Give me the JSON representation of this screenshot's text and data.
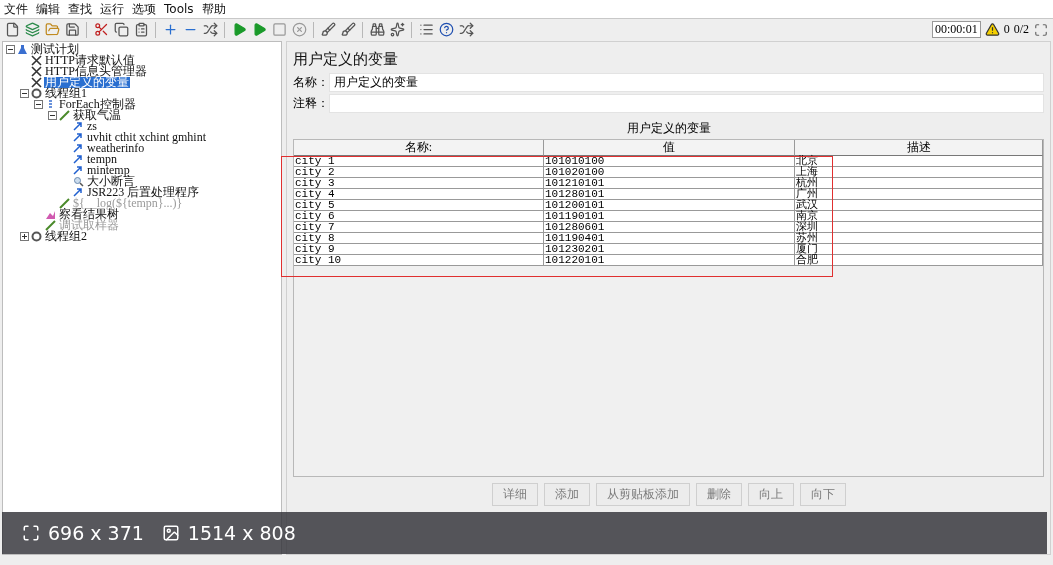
{
  "menu": [
    "文件",
    "编辑",
    "查找",
    "运行",
    "选项",
    "Tools",
    "帮助"
  ],
  "status": {
    "timer": "00:00:01",
    "warnings": "0",
    "threads": "0/2"
  },
  "tree": [
    {
      "label": "测试计划",
      "kind": "plan",
      "expanded": true,
      "selected": false,
      "disabled": false,
      "children": [
        {
          "label": "HTTP请求默认值",
          "kind": "config",
          "selected": false,
          "disabled": false
        },
        {
          "label": "HTTP信息头管理器",
          "kind": "config",
          "selected": false,
          "disabled": false
        },
        {
          "label": "用户定义的变量",
          "kind": "config",
          "selected": true,
          "disabled": false
        },
        {
          "label": "线程组1",
          "kind": "thread",
          "expanded": true,
          "selected": false,
          "disabled": false,
          "children": [
            {
              "label": "ForEach控制器",
              "kind": "controller",
              "expanded": true,
              "selected": false,
              "disabled": false,
              "children": [
                {
                  "label": "获取气温",
                  "kind": "sampler",
                  "expanded": true,
                  "selected": false,
                  "disabled": false,
                  "children": [
                    {
                      "label": "zs",
                      "kind": "extractor",
                      "selected": false,
                      "disabled": false
                    },
                    {
                      "label": "uvhit cthit xchint gmhint",
                      "kind": "extractor",
                      "selected": false,
                      "disabled": false
                    },
                    {
                      "label": "weatherinfo",
                      "kind": "extractor",
                      "selected": false,
                      "disabled": false
                    },
                    {
                      "label": "tempn",
                      "kind": "extractor",
                      "selected": false,
                      "disabled": false
                    },
                    {
                      "label": "mintemp",
                      "kind": "extractor",
                      "selected": false,
                      "disabled": false
                    },
                    {
                      "label": "大小断言",
                      "kind": "assertion",
                      "selected": false,
                      "disabled": false
                    },
                    {
                      "label": "JSR223 后置处理程序",
                      "kind": "extractor",
                      "selected": false,
                      "disabled": false
                    }
                  ]
                },
                {
                  "label": "${__log(${tempn}...)}",
                  "kind": "sampler",
                  "selected": false,
                  "disabled": true
                }
              ]
            },
            {
              "label": "察看结果树",
              "kind": "listener",
              "selected": false,
              "disabled": false
            },
            {
              "label": "调试取样器",
              "kind": "sampler",
              "selected": false,
              "disabled": true
            }
          ]
        },
        {
          "label": "线程组2",
          "kind": "thread",
          "expanded": false,
          "selected": false,
          "disabled": false
        }
      ]
    }
  ],
  "panel": {
    "title": "用户定义的变量",
    "name_label": "名称：",
    "name_value": "用户定义的变量",
    "comment_label": "注释：",
    "table_title": "用户定义的变量",
    "columns": [
      "名称:",
      "值",
      "描述"
    ],
    "rows": [
      [
        "city 1",
        "101010100",
        "北京"
      ],
      [
        "city 2",
        "101020100",
        "上海"
      ],
      [
        "city 3",
        "101210101",
        "杭州"
      ],
      [
        "city 4",
        "101280101",
        "广州"
      ],
      [
        "city 5",
        "101200101",
        "武汉"
      ],
      [
        "city 6",
        "101190101",
        "南京"
      ],
      [
        "city 7",
        "101280601",
        "深圳"
      ],
      [
        "city 8",
        "101190401",
        "苏州"
      ],
      [
        "city 9",
        "101230201",
        "厦门"
      ],
      [
        "city 10",
        "101220101",
        "合肥"
      ]
    ],
    "buttons": [
      {
        "label": "详细",
        "disabled": true
      },
      {
        "label": "添加",
        "disabled": true
      },
      {
        "label": "从剪贴板添加",
        "disabled": true
      },
      {
        "label": "删除",
        "disabled": true
      },
      {
        "label": "向上",
        "disabled": true
      },
      {
        "label": "向下",
        "disabled": true
      }
    ]
  },
  "viewer_bar": {
    "display_size": "696 x 371",
    "image_size": "1514 x 808"
  }
}
